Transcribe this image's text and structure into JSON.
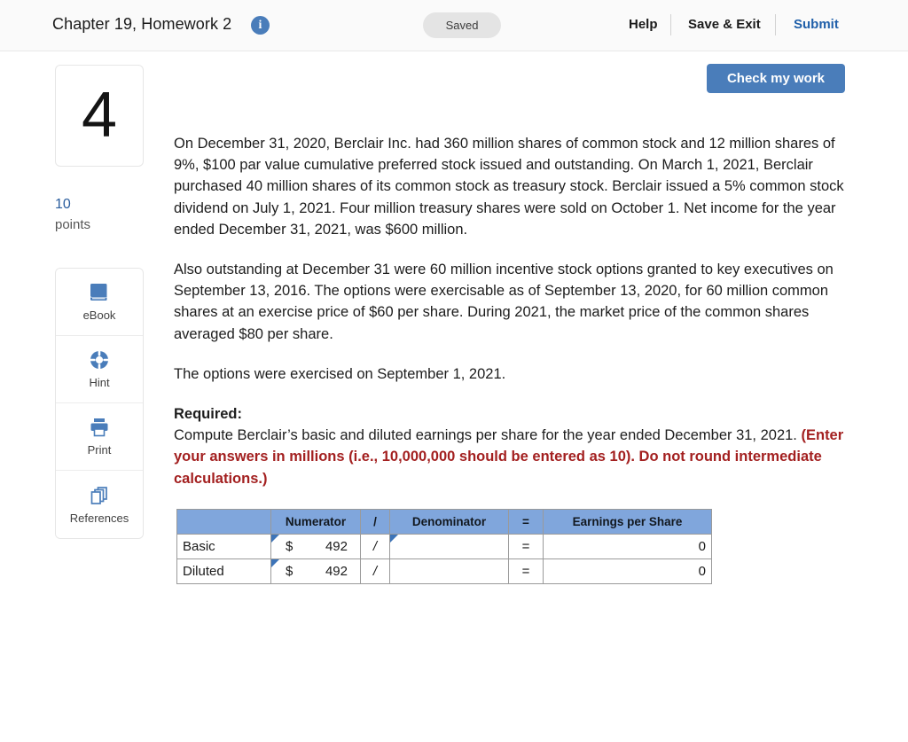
{
  "header": {
    "title": "Chapter 19, Homework 2",
    "info_icon": "info-icon",
    "status": "Saved",
    "help_label": "Help",
    "save_exit_label": "Save & Exit",
    "submit_label": "Submit",
    "submit_color": "#1f5fa9"
  },
  "sidebar": {
    "question_number": "4",
    "points_value": "10",
    "points_label": "points",
    "tools": [
      {
        "label": "eBook",
        "icon": "book-icon"
      },
      {
        "label": "Hint",
        "icon": "lifebuoy-icon"
      },
      {
        "label": "Print",
        "icon": "printer-icon"
      },
      {
        "label": "References",
        "icon": "copy-pages-icon"
      }
    ]
  },
  "toolbar": {
    "check_my_work_label": "Check my work",
    "accent_color": "#4a7dba"
  },
  "main": {
    "paragraph1": "On December 31, 2020, Berclair Inc. had 360 million shares of common stock and 12 million shares of 9%, $100 par value cumulative preferred stock issued and outstanding. On March 1, 2021, Berclair purchased 40 million shares of its common stock as treasury stock. Berclair issued a 5% common stock dividend on July 1, 2021. Four million treasury shares were sold on October 1. Net income for the year ended December 31, 2021, was $600 million.",
    "paragraph2": "Also outstanding at December 31 were 60 million incentive stock options granted to key executives on September 13, 2016. The options were exercisable as of September 13, 2020, for 60 million common shares at an exercise price of $60 per share. During 2021, the market price of the common shares averaged $80 per share.",
    "paragraph3": "The options were exercised on September 1, 2021.",
    "required_heading": "Required:",
    "required_text_plain": "Compute Berclair’s basic and diluted earnings per share for the year ended December 31, 2021. ",
    "required_text_red": "(Enter your answers in millions (i.e., 10,000,000 should be entered as 10). Do not round intermediate calculations.)",
    "required_red_color": "#a32020"
  },
  "answer_table": {
    "headers": [
      "",
      "Numerator",
      "/",
      "Denominator",
      "=",
      "Earnings per Share"
    ],
    "header_bg": "#80a6dc",
    "rows": [
      {
        "label": "Basic",
        "numerator_symbol": "$",
        "numerator_value": "492",
        "slash": "/",
        "denominator_value": "",
        "equals": "=",
        "eps_value": "0"
      },
      {
        "label": "Diluted",
        "numerator_symbol": "$",
        "numerator_value": "492",
        "slash": "/",
        "denominator_value": "",
        "equals": "=",
        "eps_value": "0"
      }
    ]
  }
}
